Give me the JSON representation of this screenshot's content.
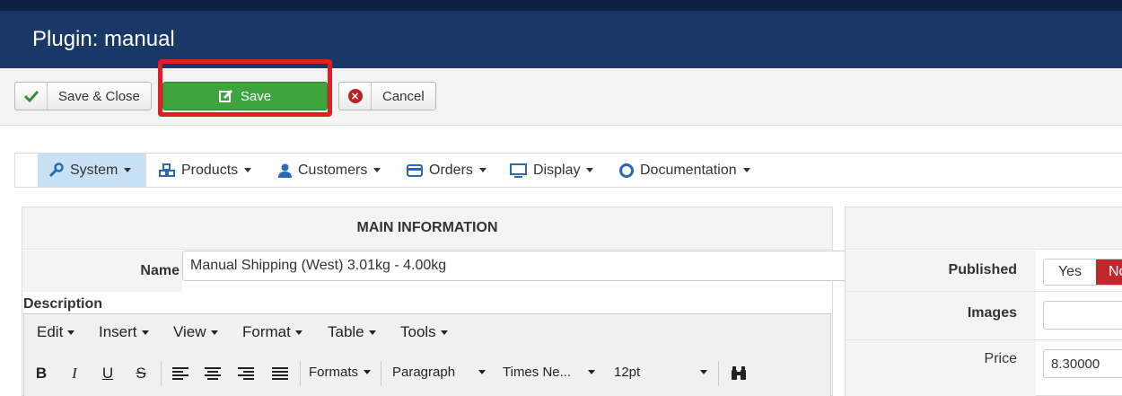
{
  "header": {
    "title": "Plugin: manual"
  },
  "toolbar": {
    "save_close_label": "Save & Close",
    "save_label": "Save",
    "cancel_label": "Cancel",
    "cancel_icon_glyph": "✕"
  },
  "menubar": {
    "items": [
      {
        "label": "System",
        "icon": "wrench-icon"
      },
      {
        "label": "Products",
        "icon": "cubes-icon"
      },
      {
        "label": "Customers",
        "icon": "user-icon"
      },
      {
        "label": "Orders",
        "icon": "credit-card-icon"
      },
      {
        "label": "Display",
        "icon": "monitor-icon"
      },
      {
        "label": "Documentation",
        "icon": "lifebuoy-icon"
      }
    ]
  },
  "main": {
    "heading": "MAIN INFORMATION",
    "name_label": "Name",
    "name_value": "Manual Shipping (West) 3.01kg - 4.00kg",
    "description_label": "Description"
  },
  "editor": {
    "menus": [
      "Edit",
      "Insert",
      "View",
      "Format",
      "Table",
      "Tools"
    ],
    "bold": "B",
    "italic": "I",
    "underline": "U",
    "strike": "S",
    "formats": "Formats",
    "block": "Paragraph",
    "font": "Times Ne...",
    "size": "12pt"
  },
  "side": {
    "published_label": "Published",
    "yes": "Yes",
    "no": "No",
    "images_label": "Images",
    "images_value": "",
    "price_label": "Price",
    "price_value": "8.30000"
  },
  "colors": {
    "header_bg": "#1a3867",
    "save_green": "#3ea43e",
    "no_red": "#c0282d",
    "active_menu": "#c9e1f5",
    "annotation_red": "#e01e24"
  }
}
